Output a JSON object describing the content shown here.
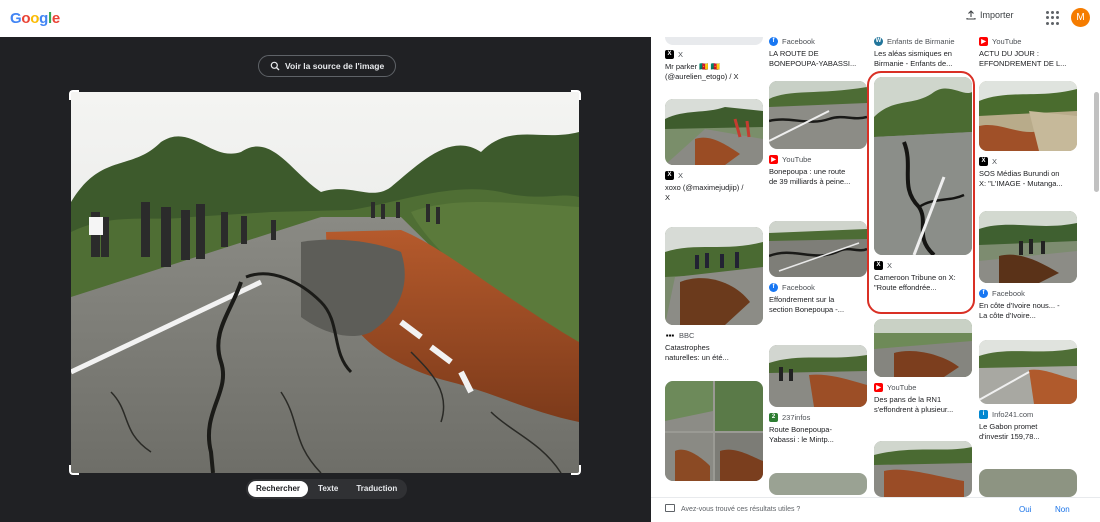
{
  "header": {
    "logo": "Google",
    "logo_colors": [
      "#4285f4",
      "#ea4335",
      "#fbbc05",
      "#4285f4",
      "#34a853",
      "#ea4335"
    ],
    "import_label": "Importer",
    "avatar_letter": "M",
    "avatar_color": "#f57c00"
  },
  "viewer": {
    "source_label": "Voir la source de l'image",
    "modes": [
      "Rechercher",
      "Texte",
      "Traduction"
    ],
    "active_mode": "Rechercher"
  },
  "results": {
    "items": [
      {
        "source": "X",
        "icon": "x-logo-icon",
        "title": "Mr parker 🇨🇲 🇨🇲\n(@aurelien_etogo) / X"
      },
      {
        "source": "X",
        "icon": "x-logo-icon",
        "title": "xoxo (@maximejudjip) /\nX"
      },
      {
        "source": "BBC",
        "icon": "bbc-logo-icon",
        "title": "Catastrophes\nnaturelles: un été..."
      },
      {
        "source": "Facebook",
        "icon": "facebook-logo-icon",
        "title": "LA ROUTE DE\nBONEPOUPA-YABASSI..."
      },
      {
        "source": "YouTube",
        "icon": "youtube-logo-icon",
        "title": "Bonepoupa : une route\nde 39 milliards à peine..."
      },
      {
        "source": "Facebook",
        "icon": "facebook-logo-icon",
        "title": "Effondrement sur la\nsection Bonepoupa -..."
      },
      {
        "source": "237infos",
        "icon": "site-logo-icon",
        "title": "Route Bonepoupa-\nYabassi : le Mintp..."
      },
      {
        "source": "Enfants de Birmanie",
        "icon": "wordpress-logo-icon",
        "title": "Les aléas sismiques en\nBirmanie - Enfants de..."
      },
      {
        "source": "X",
        "icon": "x-logo-icon",
        "title": "Cameroon Tribune on X:\n\"Route effondrée..."
      },
      {
        "source": "YouTube",
        "icon": "youtube-logo-icon",
        "title": "Des pans de la RN1\ns'effondrent à plusieur..."
      },
      {
        "source": "YouTube",
        "icon": "youtube-logo-icon",
        "title": "ACTU DU JOUR :\nEFFONDREMENT DE L..."
      },
      {
        "source": "X",
        "icon": "x-logo-icon",
        "title": "SOS Médias Burundi on\nX: \"L'IMAGE - Mutanga..."
      },
      {
        "source": "Facebook",
        "icon": "facebook-logo-icon",
        "title": "En côte d'Ivoire nous... -\nLa côte d'Ivoire..."
      },
      {
        "source": "Info241.com",
        "icon": "site-logo-icon",
        "title": "Le Gabon promet\nd'investir 159,78..."
      }
    ]
  },
  "feedback": {
    "question": "Avez-vous trouvé ces résultats utiles ?",
    "yes": "Oui",
    "no": "Non"
  }
}
